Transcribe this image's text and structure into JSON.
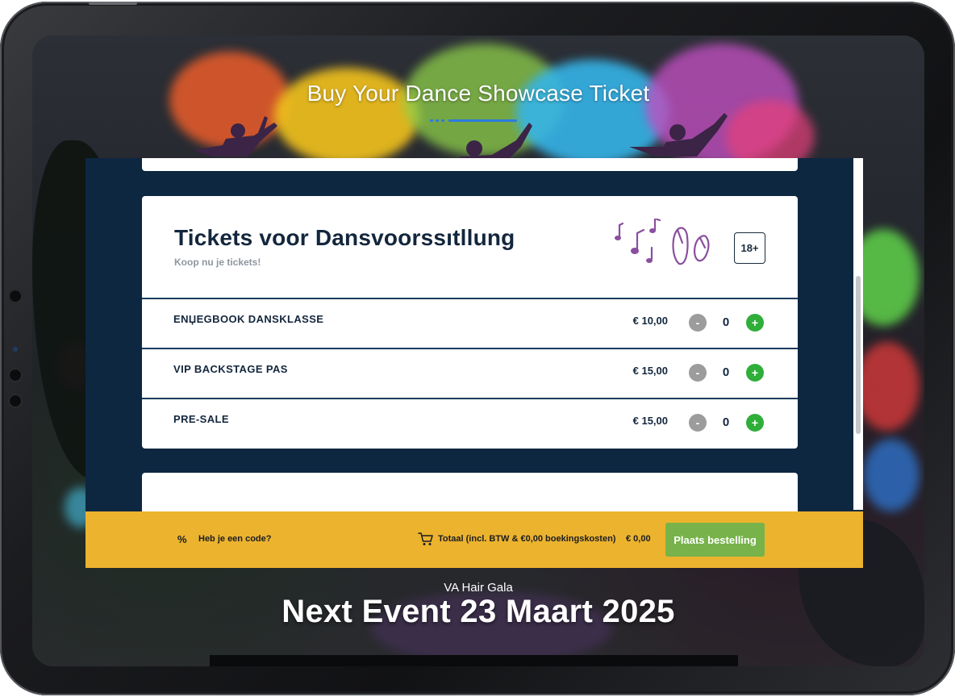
{
  "hero": {
    "title": "Buy Your Dance Showcase Ticket"
  },
  "ticket_card": {
    "title": "Tickets voor Dansvoorssıtllung",
    "subtitle": "Koop nu je tickets!",
    "age_badge": "18+",
    "decoration_icon": "music-notes-ballet-shoes-icon"
  },
  "tickets": [
    {
      "name": "ENЏEGBOOK DANSKLASSE",
      "price": "€ 10,00",
      "minus": "-",
      "quantity": "0",
      "plus": "+"
    },
    {
      "name": "VIP BACKSTAGE PAS",
      "price": "€ 15,00",
      "minus": "-",
      "quantity": "0",
      "plus": "+"
    },
    {
      "name": "PRE-SALE",
      "price": "€ 15,00",
      "minus": "-",
      "quantity": "0",
      "plus": "+"
    }
  ],
  "footer": {
    "promo_icon": "%",
    "promo_label": "Heb je een code?",
    "total_label": "Totaal (incl. BTW & €0,00 boekingskosten)",
    "total_amount": "€ 0,00",
    "order_button": "Plaats bestelling"
  },
  "event": {
    "subtitle": "VA Hair Gala",
    "title": "Next Event 23 Maart 2025"
  },
  "colors": {
    "panel_bg": "#0d2741",
    "footer_bg": "#ecb32e",
    "order_button": "#77b34a",
    "plus_button": "#2fae3a",
    "minus_button": "#9c9c9c",
    "accent_blue": "#2b7be0"
  }
}
